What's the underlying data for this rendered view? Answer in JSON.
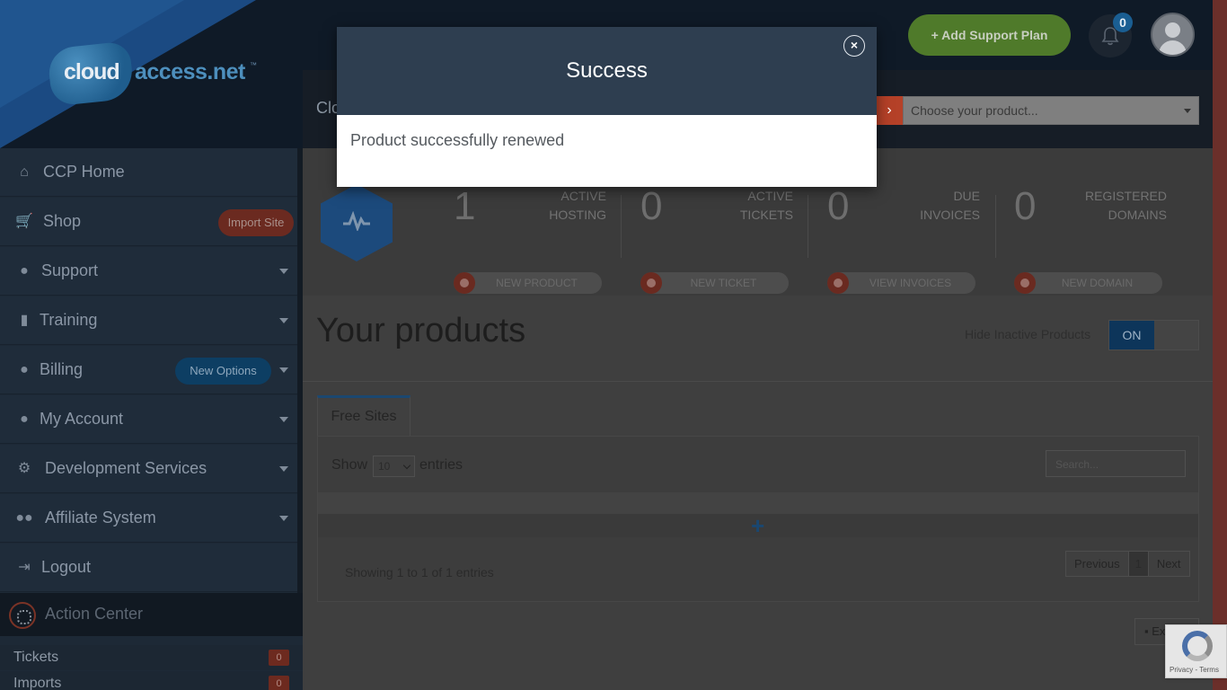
{
  "header": {
    "logo_cloud": "cloud",
    "logo_access": "access.net",
    "logo_tm": "™",
    "subbar_title": "Clo",
    "product_select_placeholder": "Choose your product...",
    "add_support_plan": "+ Add Support Plan",
    "notifications_count": "0"
  },
  "sidebar": {
    "items": [
      {
        "label": "CCP Home",
        "icon": "home-icon"
      },
      {
        "label": "Shop",
        "icon": "cart-icon",
        "badge": "Import Site"
      },
      {
        "label": "Support",
        "icon": "chat-icon"
      },
      {
        "label": "Training",
        "icon": "book-icon"
      },
      {
        "label": "Billing",
        "icon": "user-icon",
        "badge": "New Options"
      },
      {
        "label": "My Account",
        "icon": "user-icon"
      },
      {
        "label": "Development Services",
        "icon": "gears-icon"
      },
      {
        "label": "Affiliate System",
        "icon": "users-icon"
      },
      {
        "label": "Logout",
        "icon": "logout-icon"
      }
    ],
    "action_center": "Action Center",
    "ac_rows": [
      {
        "label": "Tickets",
        "count": "0"
      },
      {
        "label": "Imports",
        "count": "0"
      }
    ]
  },
  "stats": [
    {
      "value": "1",
      "line1": "ACTIVE",
      "line2": "HOSTING",
      "button": "NEW PRODUCT"
    },
    {
      "value": "0",
      "line1": "ACTIVE",
      "line2": "TICKETS",
      "button": "NEW TICKET"
    },
    {
      "value": "0",
      "line1": "DUE",
      "line2": "INVOICES",
      "button": "VIEW INVOICES"
    },
    {
      "value": "0",
      "line1": "REGISTERED",
      "line2": "DOMAINS",
      "button": "NEW DOMAIN"
    }
  ],
  "products": {
    "title": "Your products",
    "hide_inactive_label": "Hide Inactive Products",
    "toggle": "ON",
    "tab": "Free Sites",
    "show": "Show",
    "entries_select": "10",
    "entries": "entries",
    "search_placeholder": "Search...",
    "plus": "+",
    "showing": "Showing 1 to 1 of 1 entries",
    "pager": {
      "prev": "Previous",
      "current": "1",
      "next": "Next"
    },
    "export": "Ex"
  },
  "recaptcha": {
    "text": "Privacy - Terms"
  },
  "modal": {
    "title": "Success",
    "close": "×",
    "message": "Product successfully renewed"
  },
  "colors": {
    "modal_header": "#2e3e50",
    "support_green": "#4f7a2a",
    "accent_red": "#b54128",
    "accent_blue": "#1a5e92"
  }
}
